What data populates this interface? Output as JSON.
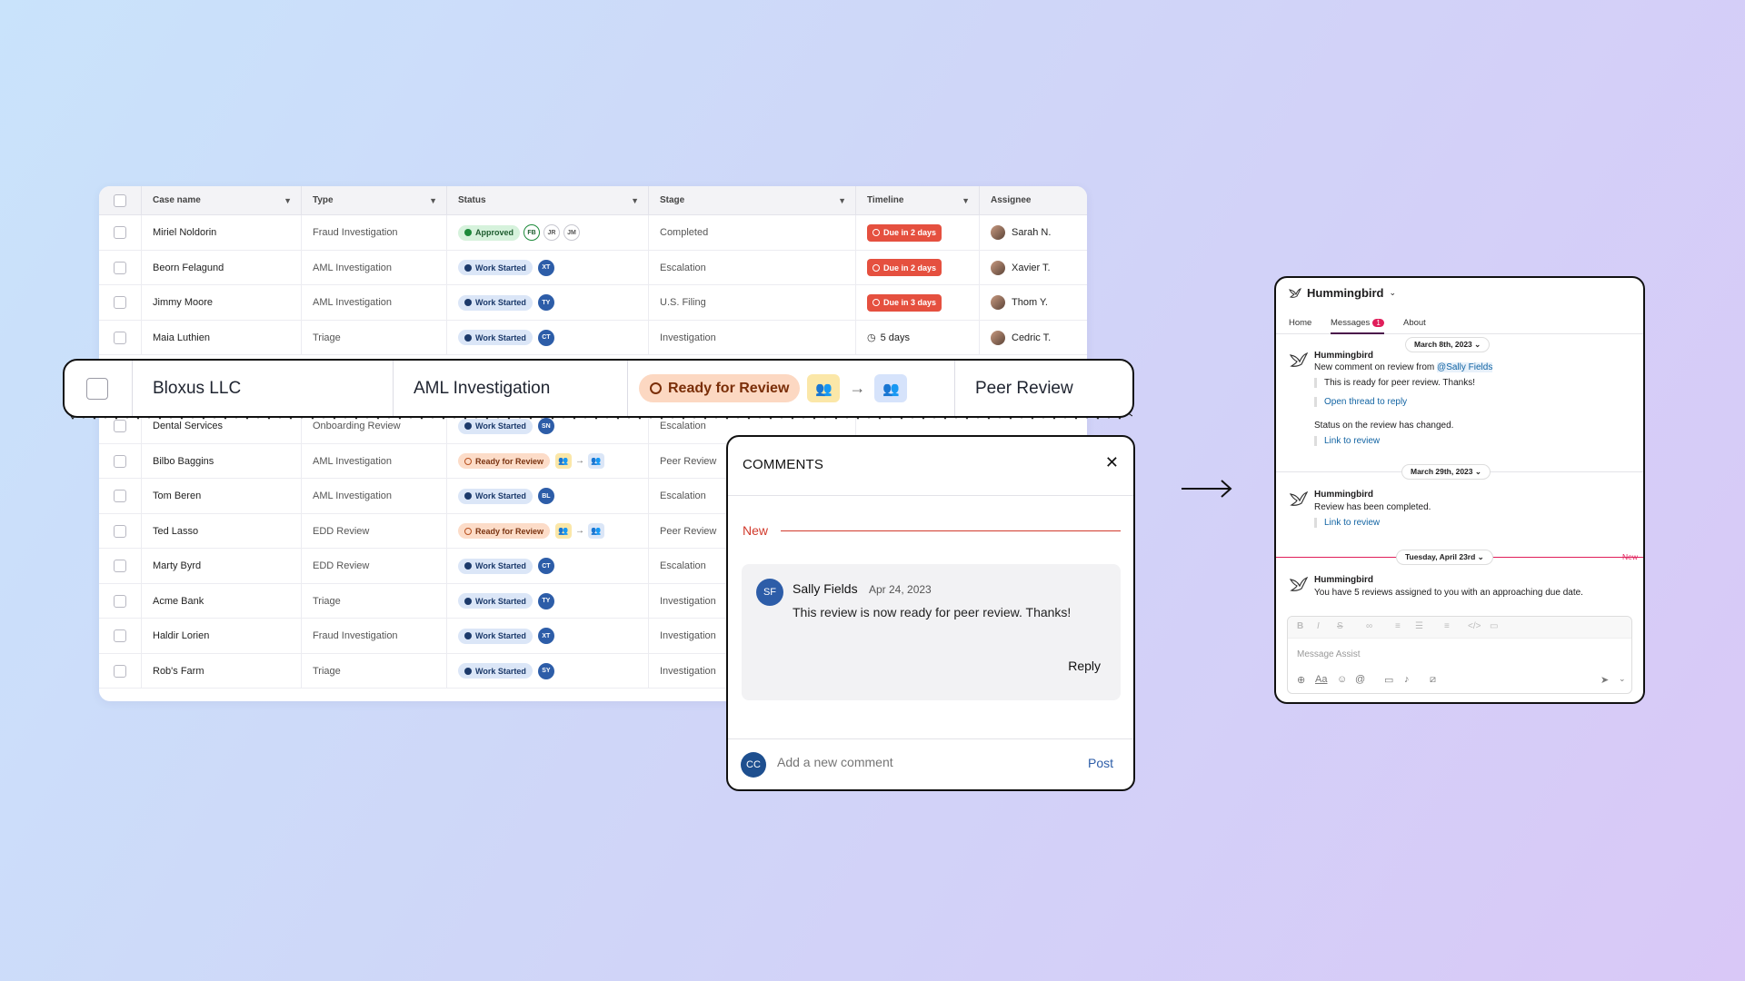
{
  "table": {
    "columns": [
      "Case name",
      "Type",
      "Status",
      "Stage",
      "Timeline",
      "Assignee"
    ],
    "rows": [
      {
        "name": "Miriel Noldorin",
        "type": "Fraud Investigation",
        "status": "Approved",
        "initials": [
          "FB",
          "JR",
          "JM"
        ],
        "stage": "Completed",
        "timeline": "Due in 2 days",
        "assignee": "Sarah N."
      },
      {
        "name": "Beorn Felagund",
        "type": "AML Investigation",
        "status": "Work Started",
        "initials": [
          "XT"
        ],
        "stage": "Escalation",
        "timeline": "Due in 2 days",
        "assignee": "Xavier T."
      },
      {
        "name": "Jimmy Moore",
        "type": "AML Investigation",
        "status": "Work Started",
        "initials": [
          "TY"
        ],
        "stage": "U.S. Filing",
        "timeline": "Due in 3 days",
        "assignee": "Thom Y."
      },
      {
        "name": "Maia Luthien",
        "type": "Triage",
        "status": "Work Started",
        "initials": [
          "CT"
        ],
        "stage": "Investigation",
        "timeline": "5 days",
        "assignee": "Cedric T."
      },
      {
        "name": "Dental Services",
        "type": "Onboarding Review",
        "status": "Work Started",
        "initials": [
          "SN"
        ],
        "stage": "Escalation"
      },
      {
        "name": "Bilbo Baggins",
        "type": "AML Investigation",
        "status": "Ready for Review",
        "stage": "Peer Review"
      },
      {
        "name": "Tom Beren",
        "type": "AML Investigation",
        "status": "Work Started",
        "initials": [
          "BL"
        ],
        "stage": "Escalation"
      },
      {
        "name": "Ted Lasso",
        "type": "EDD Review",
        "status": "Ready for Review",
        "stage": "Peer Review"
      },
      {
        "name": "Marty Byrd",
        "type": "EDD Review",
        "status": "Work Started",
        "initials": [
          "CT"
        ],
        "stage": "Escalation"
      },
      {
        "name": "Acme Bank",
        "type": "Triage",
        "status": "Work Started",
        "initials": [
          "TY"
        ],
        "stage": "Investigation"
      },
      {
        "name": "Haldir Lorien",
        "type": "Fraud Investigation",
        "status": "Work Started",
        "initials": [
          "XT"
        ],
        "stage": "Investigation"
      },
      {
        "name": "Rob's Farm",
        "type": "Triage",
        "status": "Work Started",
        "initials": [
          "SY"
        ],
        "stage": "Investigation"
      }
    ]
  },
  "zoom": {
    "name": "Bloxus LLC",
    "type": "AML Investigation",
    "status": "Ready for Review",
    "stage": "Peer Review"
  },
  "comments": {
    "title": "COMMENTS",
    "new_label": "New",
    "author_initials": "SF",
    "author": "Sally Fields",
    "date": "Apr 24, 2023",
    "text": "This review is now ready for peer review. Thanks!",
    "reply": "Reply",
    "me_initials": "CC",
    "input_placeholder": "Add a new comment",
    "post": "Post"
  },
  "slack": {
    "app_name": "Hummingbird",
    "tabs": [
      "Home",
      "Messages",
      "About"
    ],
    "badge": "1",
    "date1": "March 8th, 2023",
    "bot": "Hummingbird",
    "m1_prefix": "New comment on review from",
    "m1_mention": "@Sally Fields",
    "m1_quote": "This is ready for peer review. Thanks!",
    "m1_link": "Open thread to reply",
    "m1b": "Status on the review has changed.",
    "link_review": "Link to review",
    "date2": "March 29th, 2023",
    "m2": "Review has been completed.",
    "date3": "Tuesday, April 23rd",
    "new_tag": "New",
    "m3": "You have 5 reviews assigned to you with an approaching due date.",
    "composer_placeholder": "Message Assist"
  },
  "colors": {
    "accent_red": "#e5503f",
    "work_started": "#dbe6f7",
    "ready_review": "#fcdcc8",
    "approved": "#d6f2dc"
  }
}
